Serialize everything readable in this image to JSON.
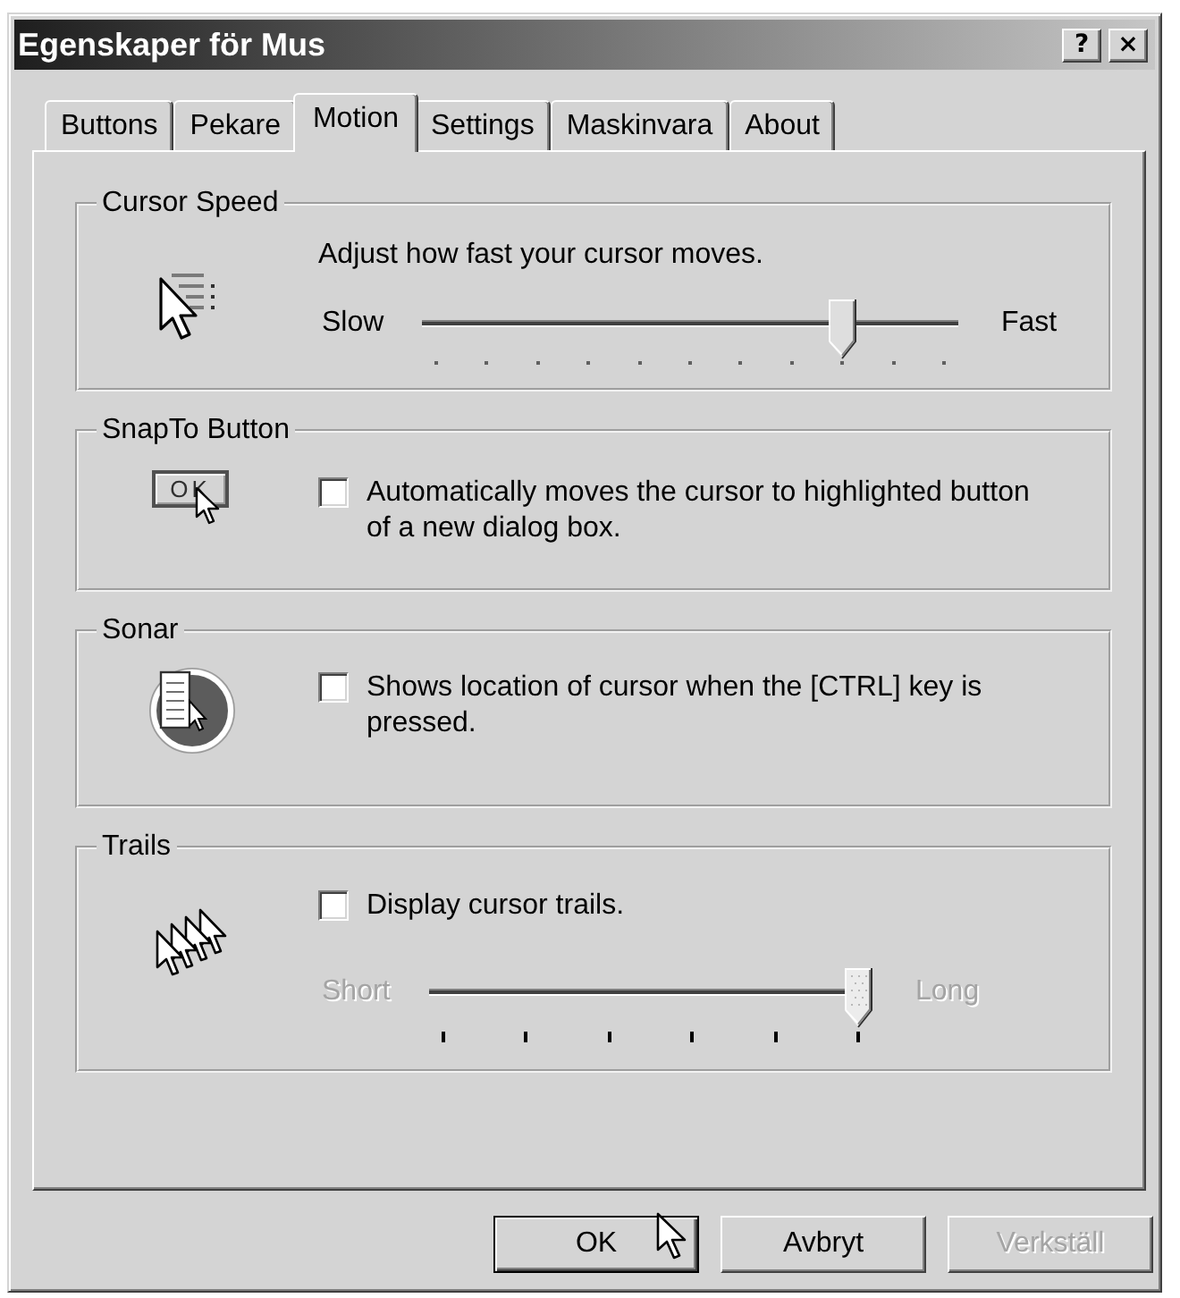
{
  "window": {
    "title": "Egenskaper för Mus",
    "buttons": [
      {
        "label": "?"
      },
      {
        "label": "×"
      }
    ]
  },
  "tabs": [
    {
      "label": "Buttons",
      "selected": false
    },
    {
      "label": "Pekare",
      "selected": false
    },
    {
      "label": "Motion",
      "selected": true
    },
    {
      "label": "Settings",
      "selected": false
    },
    {
      "label": "Maskinvara",
      "selected": false
    },
    {
      "label": "About",
      "selected": false
    }
  ],
  "groups": [
    {
      "kind": "speed",
      "title": "Cursor Speed",
      "description": "Adjust how fast your cursor moves.",
      "slider": {
        "min_label": "Slow",
        "max_label": "Fast",
        "level": 0.8,
        "disabled": false
      }
    },
    {
      "kind": "snap",
      "title": "SnapTo Button",
      "sample_label": "OK",
      "checkbox": {
        "label": "Automatically moves the cursor to highlighted button of a new dialog box.",
        "checked": false
      }
    },
    {
      "kind": "sonar",
      "title": "Sonar",
      "checkbox": {
        "label": "Shows location of cursor when the [CTRL] key is pressed.",
        "checked": false
      }
    },
    {
      "kind": "trails",
      "title": "Trails",
      "checkbox": {
        "label": "Display cursor trails.",
        "checked": false
      },
      "slider": {
        "min_label": "Short",
        "max_label": "Long",
        "level": 1,
        "disabled": true
      }
    }
  ],
  "buttons": [
    {
      "label": "OK",
      "default": true,
      "disabled": false
    },
    {
      "label": "Avbryt",
      "default": false,
      "disabled": false
    },
    {
      "label": "Verkställ",
      "default": false,
      "disabled": true
    }
  ]
}
